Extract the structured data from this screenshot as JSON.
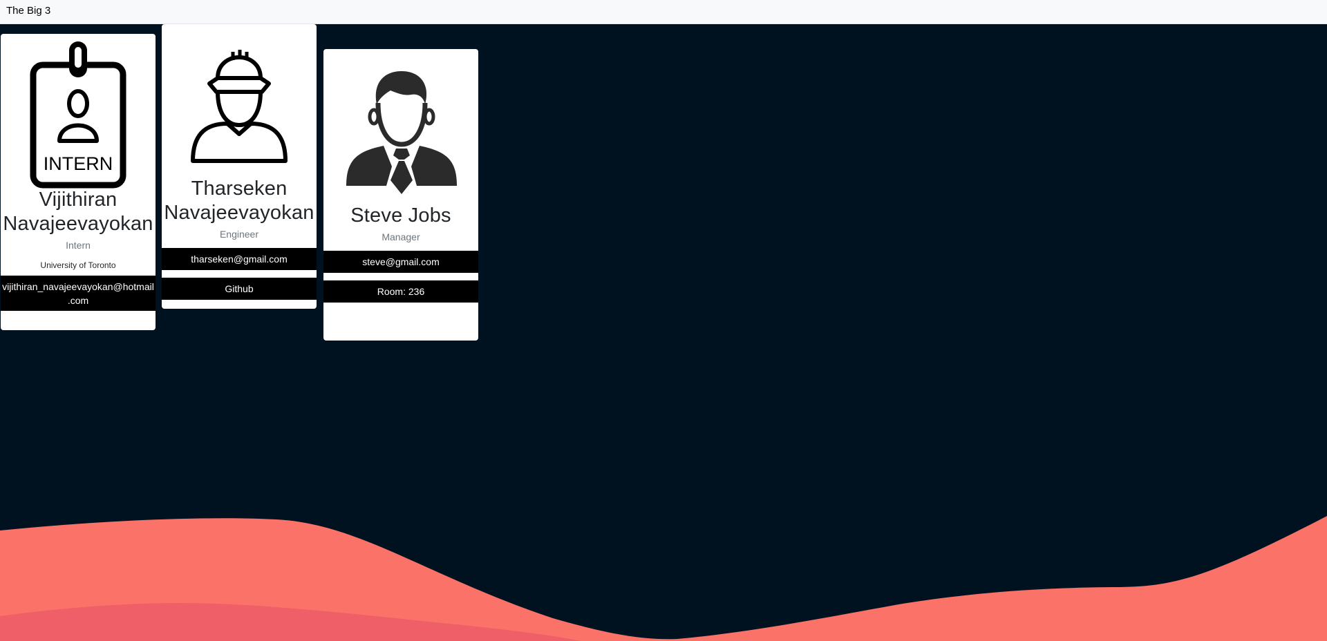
{
  "navbar": {
    "brand": "The Big 3"
  },
  "colors": {
    "background": "#001220",
    "wave_front": "#fa7268",
    "wave_back": "#ef5f67",
    "card": "#ffffff",
    "bar": "#000000"
  },
  "cards": [
    {
      "icon": "intern-badge-icon",
      "name_line1": "Vijithiran",
      "name_line2": "Navajeevayokan",
      "role": "Intern",
      "detail": "University of Toronto",
      "email_line1": "vijithiran_navajeevayokan@hotmail",
      "email_line2": ".com",
      "badge_text": "INTERN"
    },
    {
      "icon": "engineer-hardhat-icon",
      "name_line1": "Tharseken",
      "name_line2": "Navajeevayokan",
      "role": "Engineer",
      "email": "tharseken@gmail.com",
      "link": "Github"
    },
    {
      "icon": "manager-suit-icon",
      "name": "Steve Jobs",
      "role": "Manager",
      "email": "steve@gmail.com",
      "room": "Room: 236"
    }
  ]
}
